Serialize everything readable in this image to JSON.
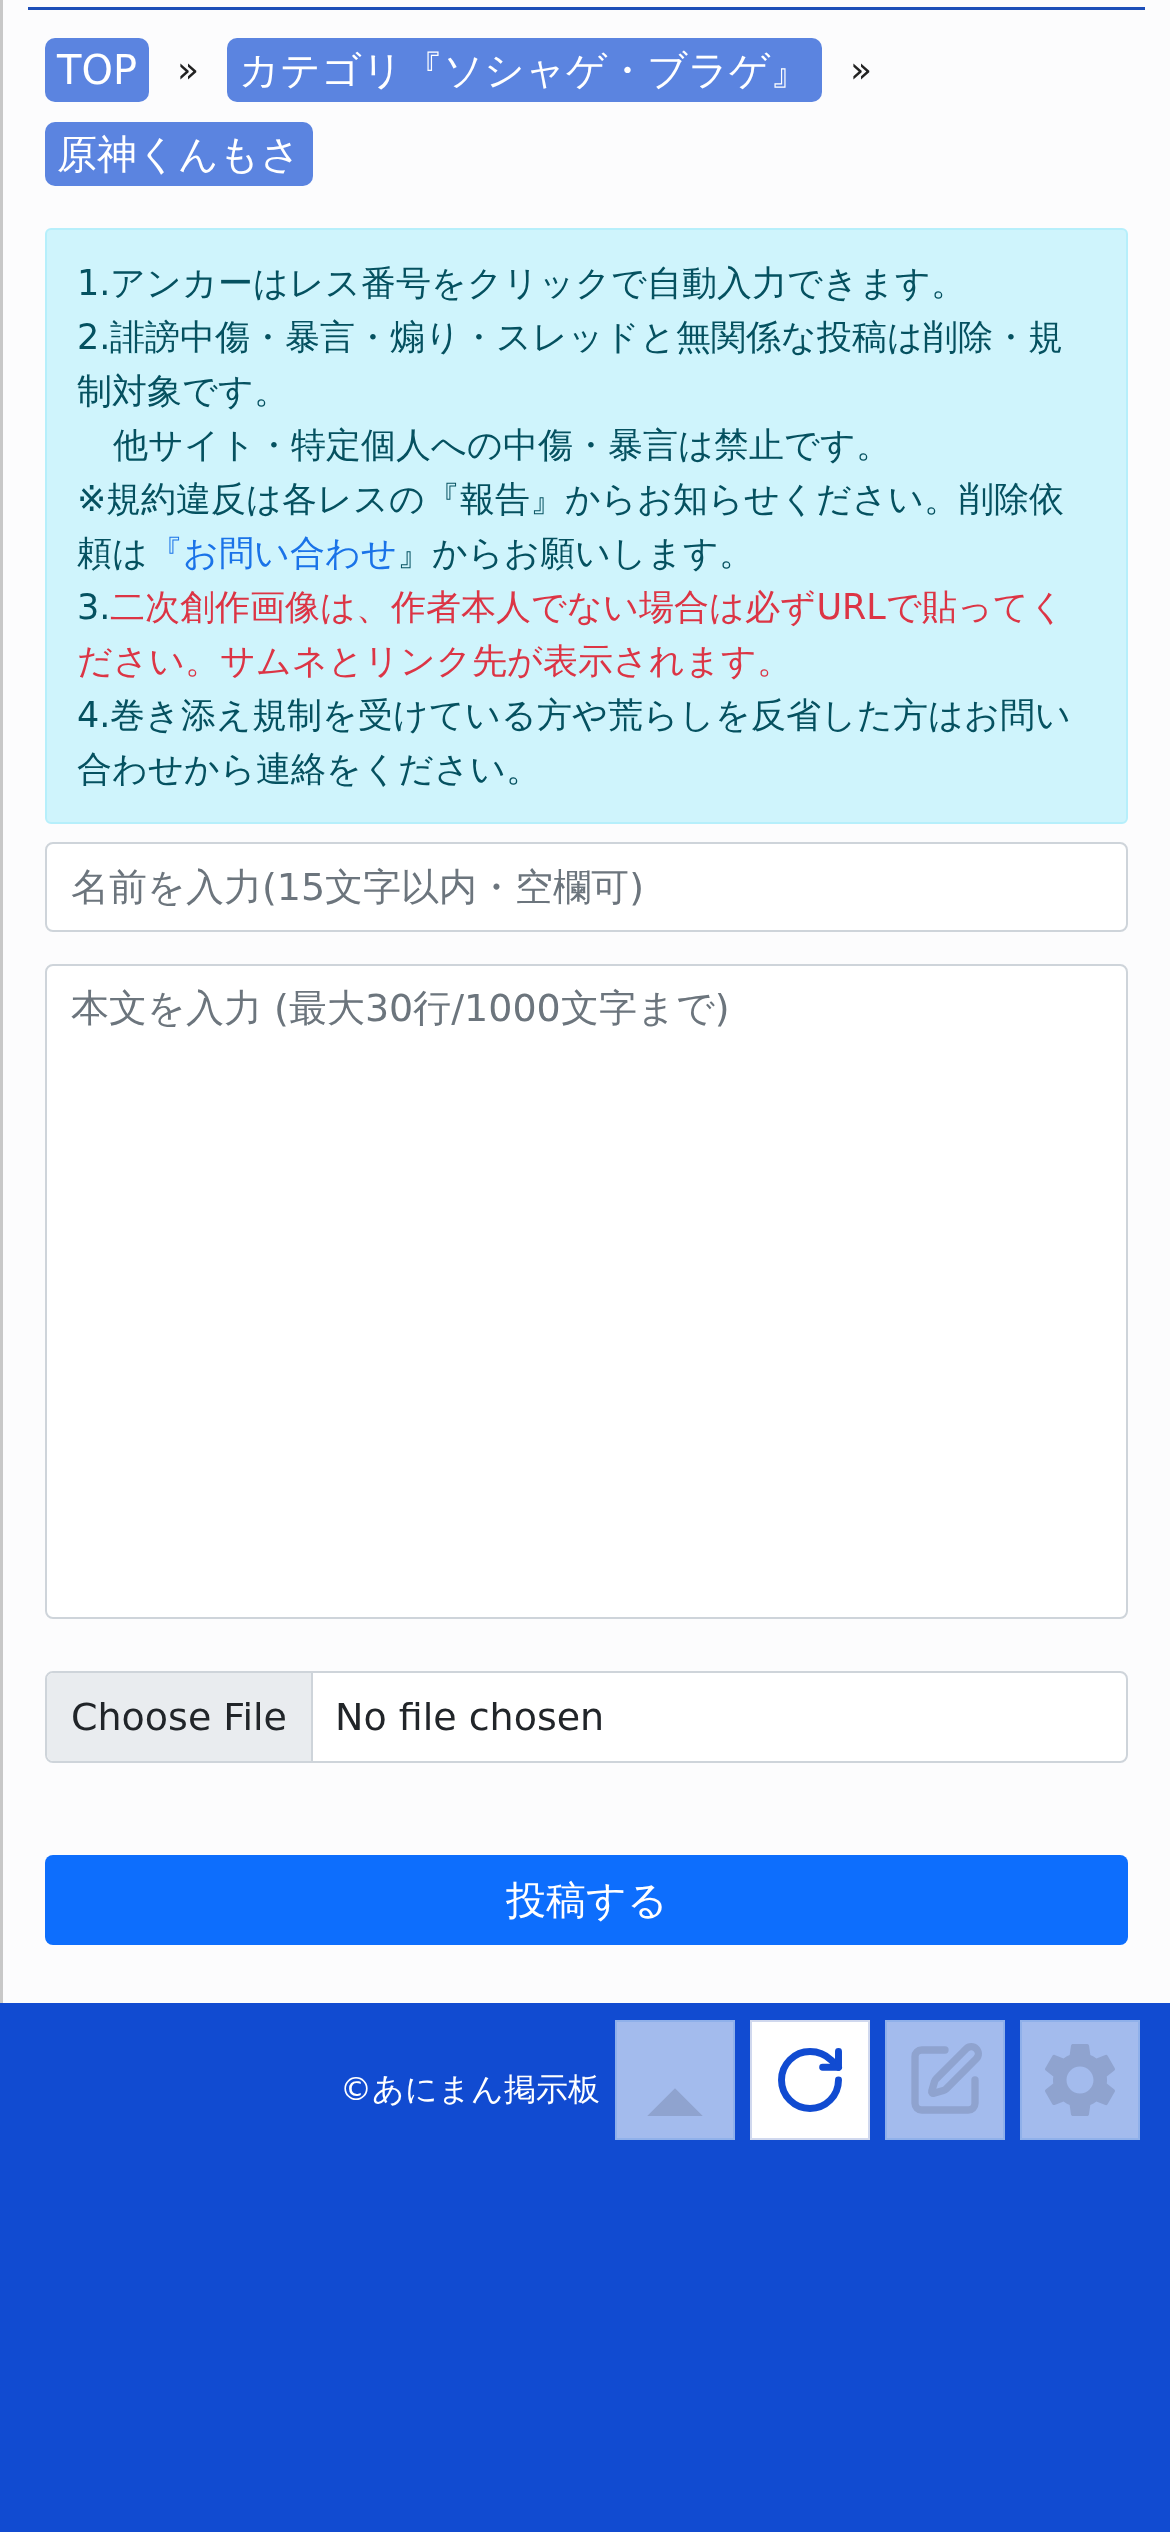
{
  "breadcrumb": [
    {
      "label": "TOP",
      "separator": "»"
    },
    {
      "label": "カテゴリ『ソシャゲ・ブラゲ』",
      "separator": "»"
    },
    {
      "label": "原神くんもさ"
    }
  ],
  "notice": [
    {
      "indent": false,
      "parts": [
        {
          "kind": "text",
          "text": "1.アンカーはレス番号をクリックで自動入力できます。"
        }
      ]
    },
    {
      "indent": false,
      "parts": [
        {
          "kind": "text",
          "text": "2.誹謗中傷・暴言・煽り・スレッドと無関係な投稿は削除・規制対象です。"
        }
      ]
    },
    {
      "indent": true,
      "parts": [
        {
          "kind": "text",
          "text": "他サイト・特定個人への中傷・暴言は禁止です。"
        }
      ]
    },
    {
      "indent": false,
      "parts": [
        {
          "kind": "text",
          "text": "※規約違反は各レスの『報告』からお知らせください。削除依頼は"
        },
        {
          "kind": "link",
          "text": "『お問い合わせ"
        },
        {
          "kind": "text",
          "text": "』からお願いします。"
        }
      ]
    },
    {
      "indent": false,
      "parts": [
        {
          "kind": "text",
          "text": "3."
        },
        {
          "kind": "warning",
          "text": "二次創作画像は、作者本人でない場合は必ずURLで貼ってください。サムネとリンク先が表示されます。"
        }
      ]
    },
    {
      "indent": false,
      "parts": [
        {
          "kind": "text",
          "text": "4.巻き添え規制を受けている方や荒らしを反省した方はお問い合わせから連絡をください。"
        }
      ]
    }
  ],
  "form": {
    "name": {
      "placeholder": "名前を入力(15文字以内・空欄可)"
    },
    "body": {
      "placeholder": "本文を入力 (最大30行/1000文字まで)"
    },
    "file": {
      "button": "Choose File",
      "status": "No file chosen"
    },
    "submit": "投稿する"
  },
  "footer": {
    "copyright": "©あにまん掲示板"
  },
  "floating_buttons": [
    {
      "kind": "up",
      "enabled": false
    },
    {
      "kind": "refresh",
      "enabled": true
    },
    {
      "kind": "edit",
      "enabled": false
    },
    {
      "kind": "settings",
      "enabled": false
    }
  ]
}
